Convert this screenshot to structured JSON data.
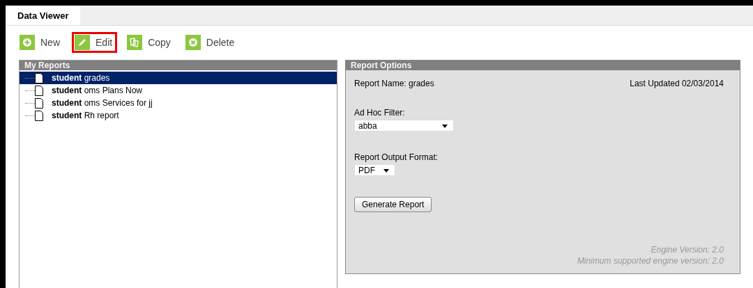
{
  "tabs": [
    {
      "label": "Data Viewer",
      "selected": true
    }
  ],
  "toolbar": [
    {
      "label": "New",
      "kind": "add",
      "highlighted": false
    },
    {
      "label": "Edit",
      "kind": "edit",
      "highlighted": true
    },
    {
      "label": "Copy",
      "kind": "copy",
      "highlighted": false
    },
    {
      "label": "Delete",
      "kind": "delete",
      "highlighted": false
    }
  ],
  "my_reports": {
    "title": "My Reports",
    "items": [
      {
        "label": "**student** grades",
        "selected": true
      },
      {
        "label": "**student** oms Plans Now",
        "selected": false
      },
      {
        "label": "**student** oms Services for jj",
        "selected": false
      },
      {
        "label": "**student** Rh report",
        "selected": false
      }
    ]
  },
  "report_options": {
    "title": "Report Options",
    "report_name": "Report Name: grades",
    "last_updated": "Last Updated 02/03/2014",
    "ad_hoc_filter": {
      "label": "Ad Hoc Filter:",
      "value": "abba"
    },
    "output_format": {
      "label": "Report Output Format:",
      "value": "PDF"
    },
    "generate_button": "Generate Report",
    "engine_version": "Engine Version: 2.0",
    "min_engine_version": "Minimum supported engine version: 2.0"
  }
}
